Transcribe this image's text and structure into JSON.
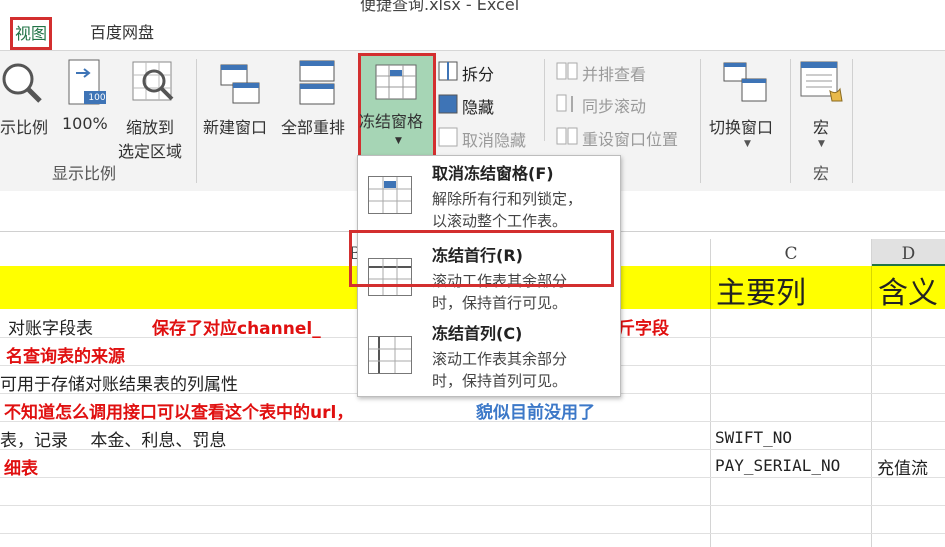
{
  "window": {
    "title": "便捷查询.xlsx - Excel"
  },
  "tabs": {
    "view": "视图",
    "baidu": "百度网盘"
  },
  "ribbon": {
    "zoom_group": {
      "zoom": "示比例",
      "hundred": "100%",
      "hundred_badge": "100",
      "zoom_selection_line1": "缩放到",
      "zoom_selection_line2": "选定区域",
      "label": "显示比例"
    },
    "window_group": {
      "new_window": "新建窗口",
      "arrange_all": "全部重排",
      "freeze_panes": "冻结窗格",
      "split": "拆分",
      "hide": "隐藏",
      "unhide": "取消隐藏",
      "side_by_side": "并排查看",
      "sync_scroll": "同步滚动",
      "reset_position": "重设窗口位置",
      "switch_window": "切换窗口"
    },
    "macro_group": {
      "macros": "宏",
      "label": "宏"
    }
  },
  "freeze_menu": {
    "items": [
      {
        "title": "取消冻结窗格(F)",
        "desc1": "解除所有行和列锁定，",
        "desc2": "以滚动整个工作表。"
      },
      {
        "title": "冻结首行(R)",
        "desc1": "滚动工作表其余部分",
        "desc2": "时，保持首行可见。"
      },
      {
        "title": "冻结首列(C)",
        "desc1": "滚动工作表其余部分",
        "desc2": "时，保持首列可见。"
      }
    ]
  },
  "sheet": {
    "columns": [
      "B",
      "C",
      "D"
    ],
    "header_row": {
      "c": "主要列",
      "d": "含义"
    },
    "rows": [
      {
        "b_plain": "对账字段表",
        "b_red": "保存了对应channel_",
        "b_tail": "斤字段"
      },
      {
        "b_red": "名查询表的来源"
      },
      {
        "b_plain": "可用于存储对账结果表的列属性"
      },
      {
        "b_red": "不知道怎么调用接口可以查看这个表中的url，",
        "b_blue": "貌似目前没用了"
      },
      {
        "b_plain": "表，记录　 本金、利息、罚息",
        "c": "SWIFT_NO"
      },
      {
        "b_red": "细表",
        "c": "PAY_SERIAL_NO",
        "d": "充值流"
      }
    ]
  },
  "colors": {
    "excel_green": "#217346",
    "highlight_red": "#d32f2f",
    "freeze_bg": "#a6d5b5",
    "header_yellow": "#ffff00"
  }
}
